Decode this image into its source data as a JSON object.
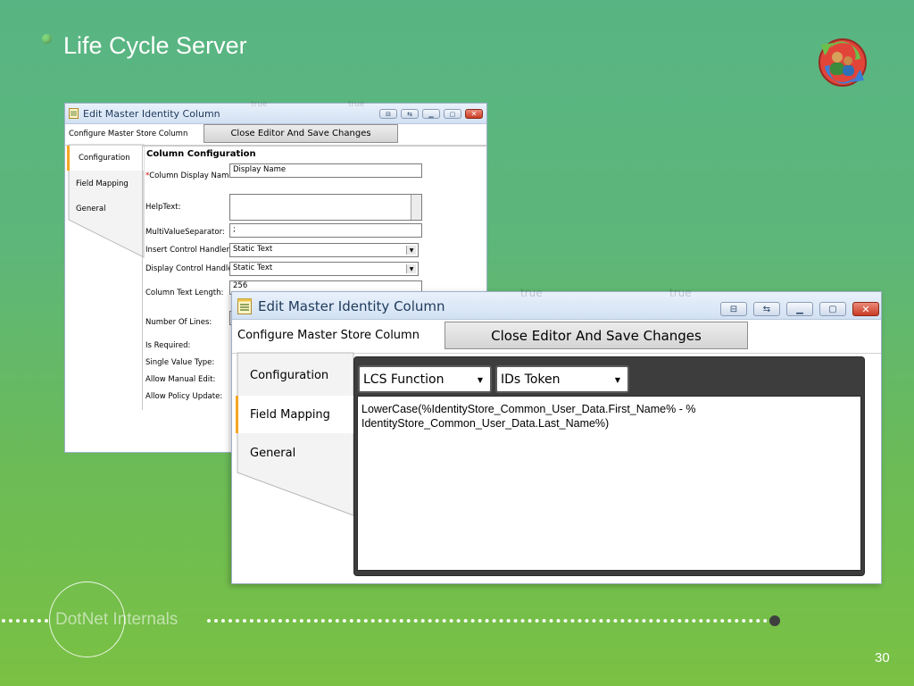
{
  "slide": {
    "title": "Life Cycle Server",
    "page_number": "30",
    "footer_brand": "DotNet Internals",
    "logo_icon": "users-sync-icon"
  },
  "colors": {
    "background_top": "#58b583",
    "background_bottom": "#7ac143",
    "tab_active_accent": "#f5a623",
    "close_button": "#c83b24",
    "field_mapping_panel": "#3d3d3d"
  },
  "window_back": {
    "title": "Edit Master Identity Column",
    "ghost_labels": [
      "true",
      "true"
    ],
    "subheader": "Configure Master Store Column",
    "close_button_label": "Close Editor And Save Changes",
    "tabs": [
      "Configuration",
      "Field Mapping",
      "General"
    ],
    "active_tab_index": 0,
    "section_title": "Column Configuration",
    "required_marker": "*",
    "fields": {
      "display_name": {
        "label": "Column Display Name:",
        "value": "Display Name"
      },
      "help_text": {
        "label": "HelpText:",
        "value": ""
      },
      "multi_value_separator": {
        "label": "MultiValueSeparator:",
        "value": ";"
      },
      "insert_control_handler": {
        "label": "Insert Control Handler:",
        "value": "Static Text"
      },
      "display_control_handler": {
        "label": "Display Control Handler:",
        "value": "Static Text"
      },
      "column_text_length": {
        "label": "Column Text Length:",
        "value": "256"
      },
      "number_of_lines": {
        "label": "Number Of Lines:"
      },
      "is_required": {
        "label": "Is Required:"
      },
      "single_value_type": {
        "label": "Single Value Type:"
      },
      "allow_manual_edit": {
        "label": "Allow Manual Edit:"
      },
      "allow_policy_update": {
        "label": "Allow Policy Update:"
      }
    }
  },
  "window_front": {
    "title": "Edit Master Identity Column",
    "ghost_labels": [
      "true",
      "true"
    ],
    "subheader": "Configure Master Store Column",
    "close_button_label": "Close Editor And Save Changes",
    "tabs": [
      "Configuration",
      "Field Mapping",
      "General"
    ],
    "active_tab_index": 1,
    "function_select": "LCS Function",
    "token_select": "IDs Token",
    "expression": "LowerCase(%IdentityStore_Common_User_Data.First_Name% - %\nIdentityStore_Common_User_Data.Last_Name%)"
  }
}
